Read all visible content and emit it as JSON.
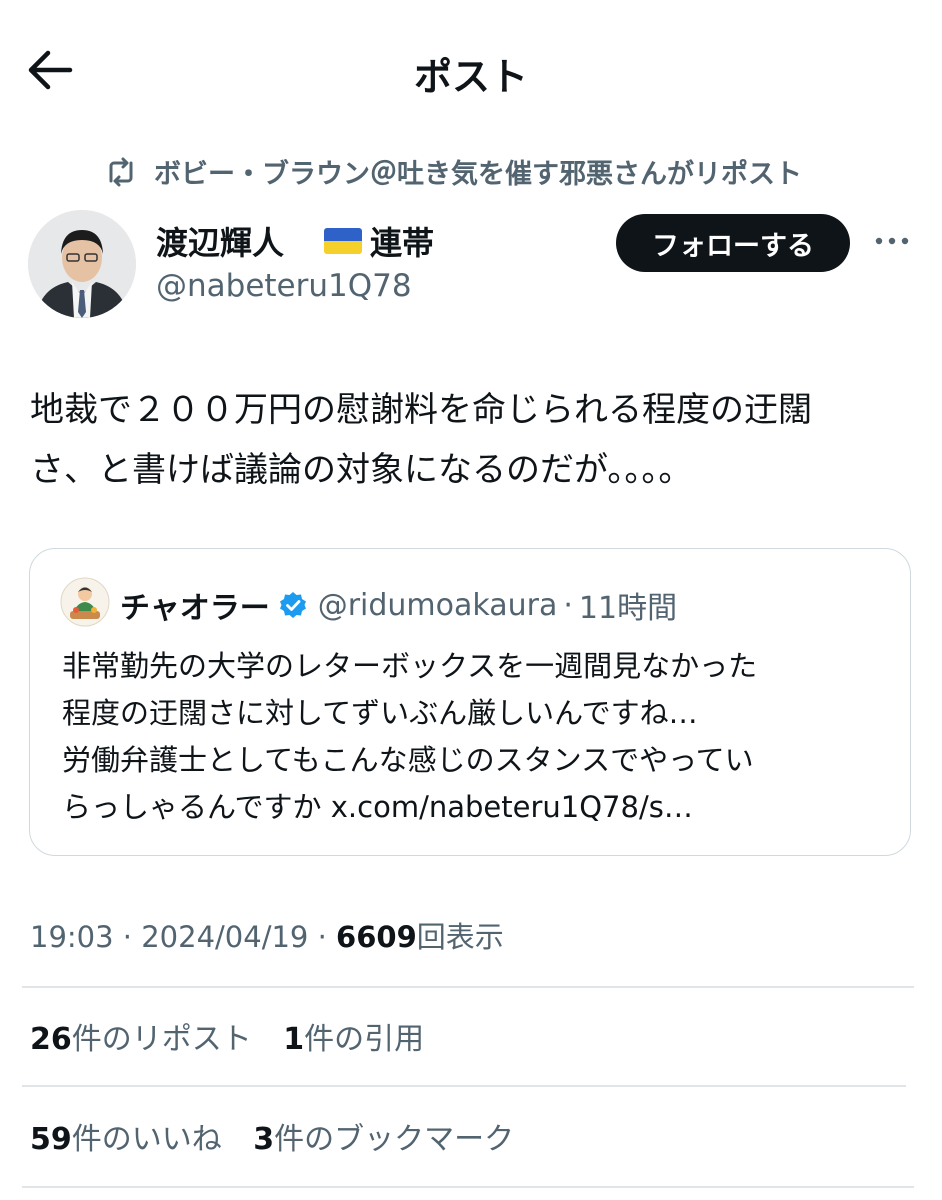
{
  "header": {
    "title": "ポスト"
  },
  "repost": {
    "text": "ボビー・ブラウン＠吐き気を催す邪悪さんがリポスト"
  },
  "author": {
    "name": "渡辺輝人",
    "badge": "連帯",
    "handle": "@nabeteru1Q78",
    "follow_label": "フォローする"
  },
  "tweet": {
    "lines": [
      "地裁で２００万円の慰謝料を命じられる程度の迂闊",
      "さ、と書けば議論の対象になるのだが。。。。"
    ]
  },
  "quote": {
    "name": "チャオラー",
    "handle": "@ridumoakaura",
    "separator": "·",
    "time": "11時間",
    "lines": [
      "非常勤先の大学のレターボックスを一週間見なかった",
      "程度の迂闊さに対してずいぶん厳しいんですね…",
      "労働弁護士としてもこんな感じのスタンスでやってい",
      "らっしゃるんですか x.com/nabeteru1Q78/s…"
    ]
  },
  "meta": {
    "time": "19:03",
    "sep": "·",
    "date": "2024/04/19",
    "views": "6609",
    "views_label": "回表示"
  },
  "stats": {
    "reposts": "26",
    "reposts_label": "件のリポスト",
    "quotes": "1",
    "quotes_label": "件の引用",
    "likes": "59",
    "likes_label": "件のいいね",
    "bookmarks": "3",
    "bookmarks_label": "件のブックマーク"
  },
  "colors": {
    "text": "#0f1419",
    "secondary": "#536471",
    "verified": "#1d9bf0",
    "border": "#cfd9de"
  }
}
